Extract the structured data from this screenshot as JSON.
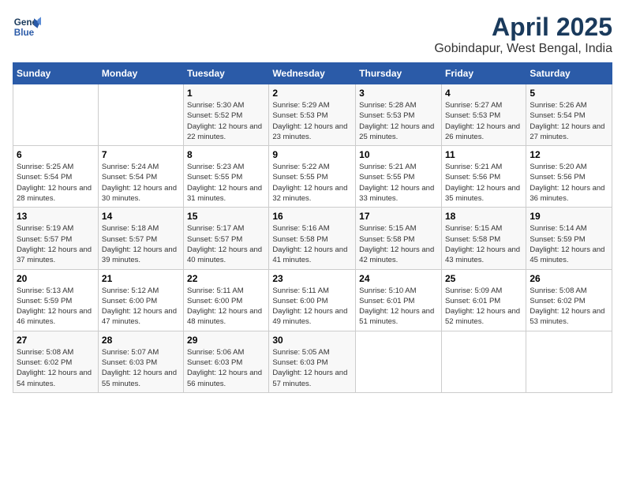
{
  "header": {
    "logo_line1": "General",
    "logo_line2": "Blue",
    "title": "April 2025",
    "subtitle": "Gobindapur, West Bengal, India"
  },
  "weekdays": [
    "Sunday",
    "Monday",
    "Tuesday",
    "Wednesday",
    "Thursday",
    "Friday",
    "Saturday"
  ],
  "weeks": [
    [
      {
        "num": "",
        "info": ""
      },
      {
        "num": "",
        "info": ""
      },
      {
        "num": "1",
        "info": "Sunrise: 5:30 AM\nSunset: 5:52 PM\nDaylight: 12 hours and 22 minutes."
      },
      {
        "num": "2",
        "info": "Sunrise: 5:29 AM\nSunset: 5:53 PM\nDaylight: 12 hours and 23 minutes."
      },
      {
        "num": "3",
        "info": "Sunrise: 5:28 AM\nSunset: 5:53 PM\nDaylight: 12 hours and 25 minutes."
      },
      {
        "num": "4",
        "info": "Sunrise: 5:27 AM\nSunset: 5:53 PM\nDaylight: 12 hours and 26 minutes."
      },
      {
        "num": "5",
        "info": "Sunrise: 5:26 AM\nSunset: 5:54 PM\nDaylight: 12 hours and 27 minutes."
      }
    ],
    [
      {
        "num": "6",
        "info": "Sunrise: 5:25 AM\nSunset: 5:54 PM\nDaylight: 12 hours and 28 minutes."
      },
      {
        "num": "7",
        "info": "Sunrise: 5:24 AM\nSunset: 5:54 PM\nDaylight: 12 hours and 30 minutes."
      },
      {
        "num": "8",
        "info": "Sunrise: 5:23 AM\nSunset: 5:55 PM\nDaylight: 12 hours and 31 minutes."
      },
      {
        "num": "9",
        "info": "Sunrise: 5:22 AM\nSunset: 5:55 PM\nDaylight: 12 hours and 32 minutes."
      },
      {
        "num": "10",
        "info": "Sunrise: 5:21 AM\nSunset: 5:55 PM\nDaylight: 12 hours and 33 minutes."
      },
      {
        "num": "11",
        "info": "Sunrise: 5:21 AM\nSunset: 5:56 PM\nDaylight: 12 hours and 35 minutes."
      },
      {
        "num": "12",
        "info": "Sunrise: 5:20 AM\nSunset: 5:56 PM\nDaylight: 12 hours and 36 minutes."
      }
    ],
    [
      {
        "num": "13",
        "info": "Sunrise: 5:19 AM\nSunset: 5:57 PM\nDaylight: 12 hours and 37 minutes."
      },
      {
        "num": "14",
        "info": "Sunrise: 5:18 AM\nSunset: 5:57 PM\nDaylight: 12 hours and 39 minutes."
      },
      {
        "num": "15",
        "info": "Sunrise: 5:17 AM\nSunset: 5:57 PM\nDaylight: 12 hours and 40 minutes."
      },
      {
        "num": "16",
        "info": "Sunrise: 5:16 AM\nSunset: 5:58 PM\nDaylight: 12 hours and 41 minutes."
      },
      {
        "num": "17",
        "info": "Sunrise: 5:15 AM\nSunset: 5:58 PM\nDaylight: 12 hours and 42 minutes."
      },
      {
        "num": "18",
        "info": "Sunrise: 5:15 AM\nSunset: 5:58 PM\nDaylight: 12 hours and 43 minutes."
      },
      {
        "num": "19",
        "info": "Sunrise: 5:14 AM\nSunset: 5:59 PM\nDaylight: 12 hours and 45 minutes."
      }
    ],
    [
      {
        "num": "20",
        "info": "Sunrise: 5:13 AM\nSunset: 5:59 PM\nDaylight: 12 hours and 46 minutes."
      },
      {
        "num": "21",
        "info": "Sunrise: 5:12 AM\nSunset: 6:00 PM\nDaylight: 12 hours and 47 minutes."
      },
      {
        "num": "22",
        "info": "Sunrise: 5:11 AM\nSunset: 6:00 PM\nDaylight: 12 hours and 48 minutes."
      },
      {
        "num": "23",
        "info": "Sunrise: 5:11 AM\nSunset: 6:00 PM\nDaylight: 12 hours and 49 minutes."
      },
      {
        "num": "24",
        "info": "Sunrise: 5:10 AM\nSunset: 6:01 PM\nDaylight: 12 hours and 51 minutes."
      },
      {
        "num": "25",
        "info": "Sunrise: 5:09 AM\nSunset: 6:01 PM\nDaylight: 12 hours and 52 minutes."
      },
      {
        "num": "26",
        "info": "Sunrise: 5:08 AM\nSunset: 6:02 PM\nDaylight: 12 hours and 53 minutes."
      }
    ],
    [
      {
        "num": "27",
        "info": "Sunrise: 5:08 AM\nSunset: 6:02 PM\nDaylight: 12 hours and 54 minutes."
      },
      {
        "num": "28",
        "info": "Sunrise: 5:07 AM\nSunset: 6:03 PM\nDaylight: 12 hours and 55 minutes."
      },
      {
        "num": "29",
        "info": "Sunrise: 5:06 AM\nSunset: 6:03 PM\nDaylight: 12 hours and 56 minutes."
      },
      {
        "num": "30",
        "info": "Sunrise: 5:05 AM\nSunset: 6:03 PM\nDaylight: 12 hours and 57 minutes."
      },
      {
        "num": "",
        "info": ""
      },
      {
        "num": "",
        "info": ""
      },
      {
        "num": "",
        "info": ""
      }
    ]
  ]
}
